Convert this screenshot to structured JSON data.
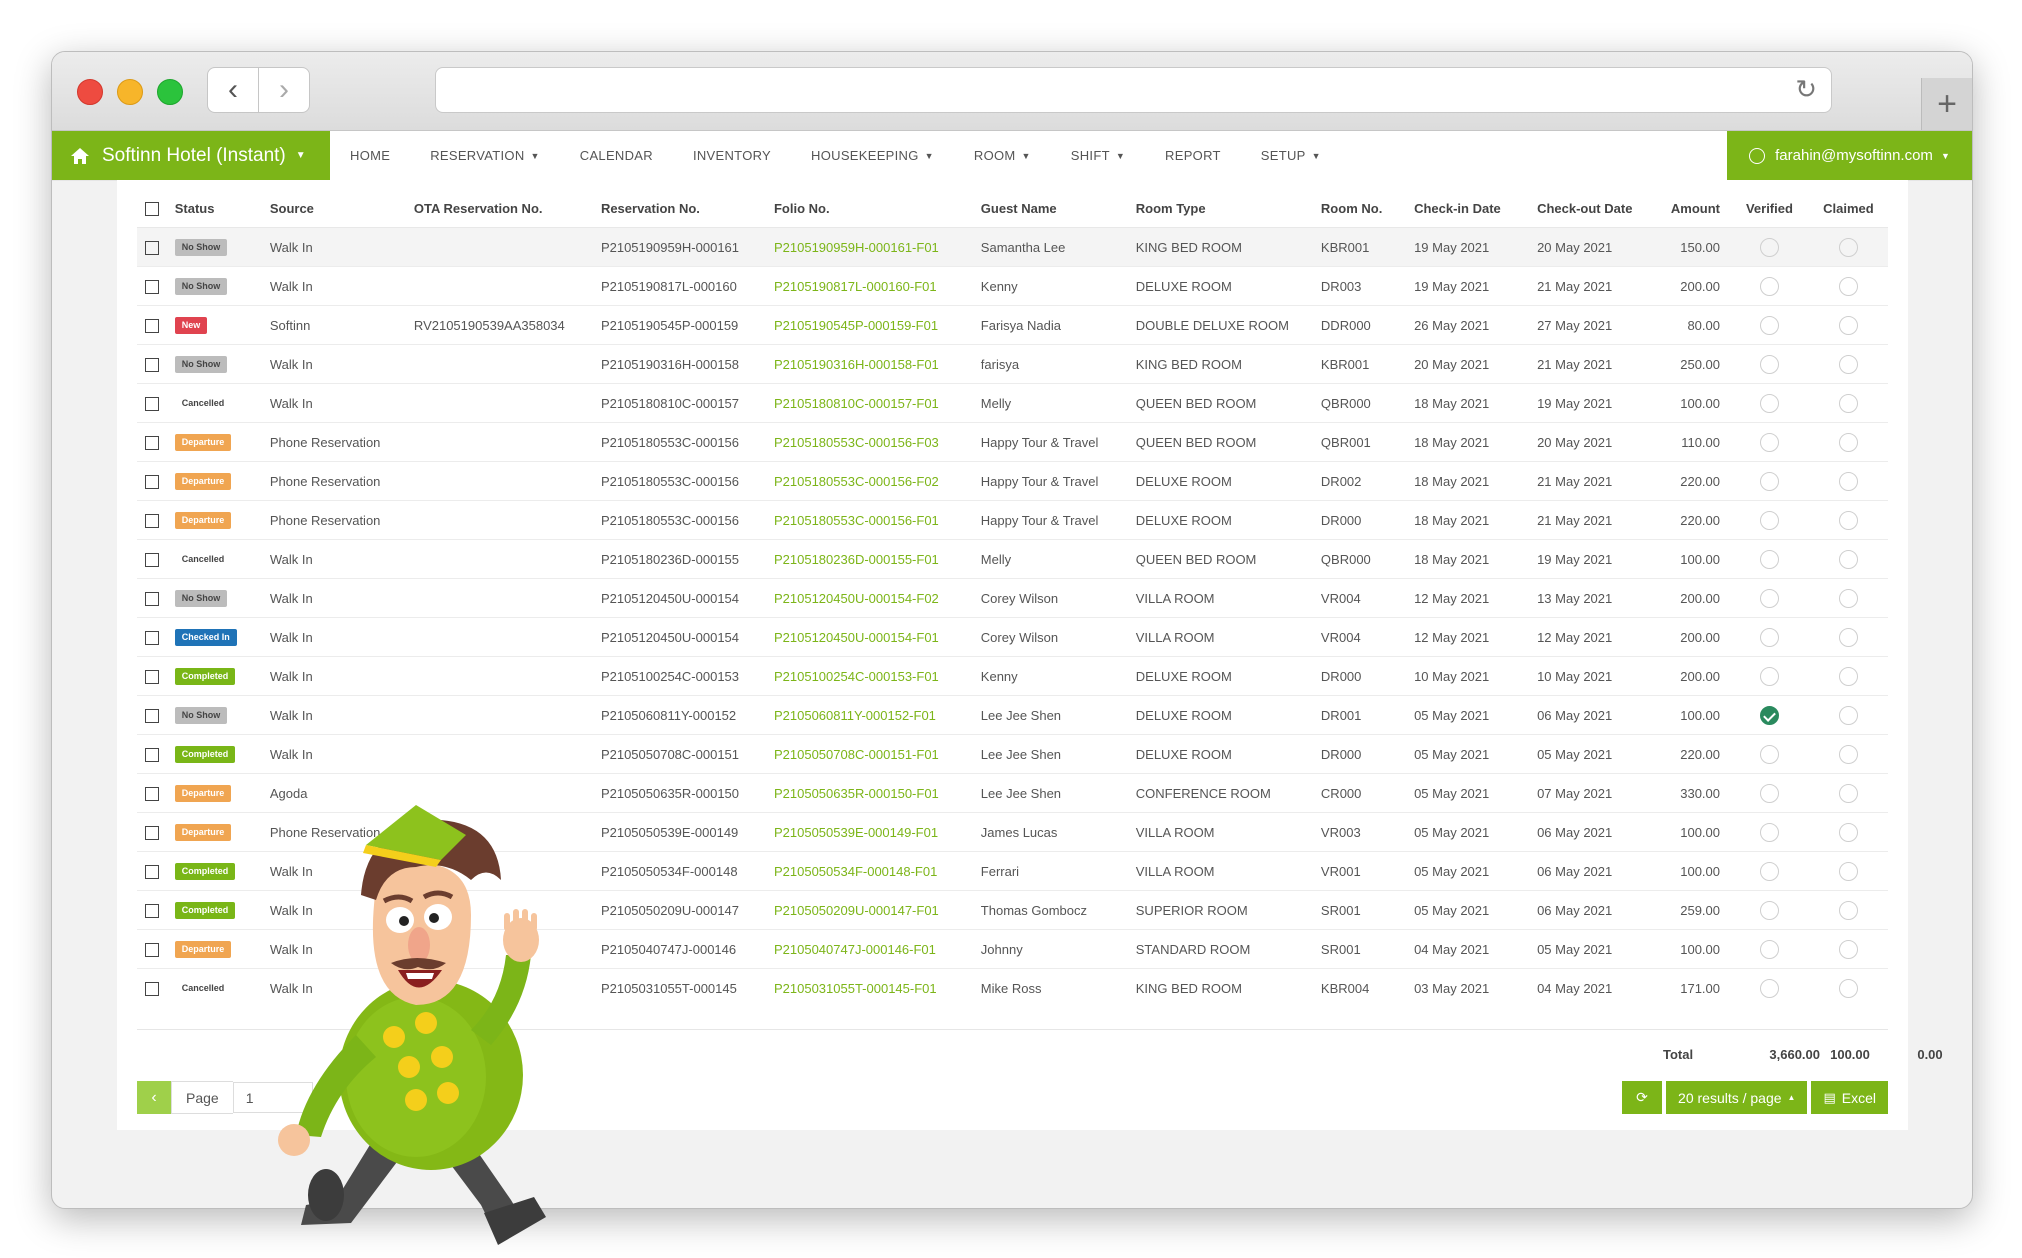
{
  "app": {
    "brand": "Softinn Hotel (Instant)",
    "user": "farahin@mysoftinn.com",
    "menu": [
      "HOME",
      "RESERVATION",
      "CALENDAR",
      "INVENTORY",
      "HOUSEKEEPING",
      "ROOM",
      "SHIFT",
      "REPORT",
      "SETUP"
    ]
  },
  "table": {
    "headers": {
      "status": "Status",
      "source": "Source",
      "ota": "OTA Reservation No.",
      "reservation": "Reservation No.",
      "folio": "Folio No.",
      "guest": "Guest Name",
      "room_type": "Room Type",
      "room_no": "Room No.",
      "checkin": "Check-in Date",
      "checkout": "Check-out Date",
      "amount": "Amount",
      "verified": "Verified",
      "claimed": "Claimed"
    },
    "rows": [
      {
        "status": "No Show",
        "source": "Walk In",
        "ota": "",
        "reservation": "P2105190959H-000161",
        "folio": "P2105190959H-000161-F01",
        "guest": "Samantha Lee",
        "room_type": "KING BED ROOM",
        "room_no": "KBR001",
        "checkin": "19 May 2021",
        "checkout": "20 May 2021",
        "amount": "150.00",
        "verified": false
      },
      {
        "status": "No Show",
        "source": "Walk In",
        "ota": "",
        "reservation": "P2105190817L-000160",
        "folio": "P2105190817L-000160-F01",
        "guest": "Kenny",
        "room_type": "DELUXE ROOM",
        "room_no": "DR003",
        "checkin": "19 May 2021",
        "checkout": "21 May 2021",
        "amount": "200.00",
        "verified": false
      },
      {
        "status": "New",
        "source": "Softinn",
        "ota": "RV2105190539AA358034",
        "reservation": "P2105190545P-000159",
        "folio": "P2105190545P-000159-F01",
        "guest": "Farisya Nadia",
        "room_type": "DOUBLE DELUXE ROOM",
        "room_no": "DDR000",
        "checkin": "26 May 2021",
        "checkout": "27 May 2021",
        "amount": "80.00",
        "verified": false
      },
      {
        "status": "No Show",
        "source": "Walk In",
        "ota": "",
        "reservation": "P2105190316H-000158",
        "folio": "P2105190316H-000158-F01",
        "guest": "farisya",
        "room_type": "KING BED ROOM",
        "room_no": "KBR001",
        "checkin": "20 May 2021",
        "checkout": "21 May 2021",
        "amount": "250.00",
        "verified": false
      },
      {
        "status": "Cancelled",
        "source": "Walk In",
        "ota": "",
        "reservation": "P2105180810C-000157",
        "folio": "P2105180810C-000157-F01",
        "guest": "Melly",
        "room_type": "QUEEN BED ROOM",
        "room_no": "QBR000",
        "checkin": "18 May 2021",
        "checkout": "19 May 2021",
        "amount": "100.00",
        "verified": false
      },
      {
        "status": "Departure",
        "source": "Phone Reservation",
        "ota": "",
        "reservation": "P2105180553C-000156",
        "folio": "P2105180553C-000156-F03",
        "guest": "Happy Tour & Travel",
        "room_type": "QUEEN BED ROOM",
        "room_no": "QBR001",
        "checkin": "18 May 2021",
        "checkout": "20 May 2021",
        "amount": "110.00",
        "verified": false
      },
      {
        "status": "Departure",
        "source": "Phone Reservation",
        "ota": "",
        "reservation": "P2105180553C-000156",
        "folio": "P2105180553C-000156-F02",
        "guest": "Happy Tour & Travel",
        "room_type": "DELUXE ROOM",
        "room_no": "DR002",
        "checkin": "18 May 2021",
        "checkout": "21 May 2021",
        "amount": "220.00",
        "verified": false
      },
      {
        "status": "Departure",
        "source": "Phone Reservation",
        "ota": "",
        "reservation": "P2105180553C-000156",
        "folio": "P2105180553C-000156-F01",
        "guest": "Happy Tour & Travel",
        "room_type": "DELUXE ROOM",
        "room_no": "DR000",
        "checkin": "18 May 2021",
        "checkout": "21 May 2021",
        "amount": "220.00",
        "verified": false
      },
      {
        "status": "Cancelled",
        "source": "Walk In",
        "ota": "",
        "reservation": "P2105180236D-000155",
        "folio": "P2105180236D-000155-F01",
        "guest": "Melly",
        "room_type": "QUEEN BED ROOM",
        "room_no": "QBR000",
        "checkin": "18 May 2021",
        "checkout": "19 May 2021",
        "amount": "100.00",
        "verified": false
      },
      {
        "status": "No Show",
        "source": "Walk In",
        "ota": "",
        "reservation": "P2105120450U-000154",
        "folio": "P2105120450U-000154-F02",
        "guest": "Corey Wilson",
        "room_type": "VILLA ROOM",
        "room_no": "VR004",
        "checkin": "12 May 2021",
        "checkout": "13 May 2021",
        "amount": "200.00",
        "verified": false
      },
      {
        "status": "Checked In",
        "source": "Walk In",
        "ota": "",
        "reservation": "P2105120450U-000154",
        "folio": "P2105120450U-000154-F01",
        "guest": "Corey Wilson",
        "room_type": "VILLA ROOM",
        "room_no": "VR004",
        "checkin": "12 May 2021",
        "checkout": "12 May 2021",
        "amount": "200.00",
        "verified": false
      },
      {
        "status": "Completed",
        "source": "Walk In",
        "ota": "",
        "reservation": "P2105100254C-000153",
        "folio": "P2105100254C-000153-F01",
        "guest": "Kenny",
        "room_type": "DELUXE ROOM",
        "room_no": "DR000",
        "checkin": "10 May 2021",
        "checkout": "10 May 2021",
        "amount": "200.00",
        "verified": false
      },
      {
        "status": "No Show",
        "source": "Walk In",
        "ota": "",
        "reservation": "P2105060811Y-000152",
        "folio": "P2105060811Y-000152-F01",
        "guest": "Lee Jee Shen",
        "room_type": "DELUXE ROOM",
        "room_no": "DR001",
        "checkin": "05 May 2021",
        "checkout": "06 May 2021",
        "amount": "100.00",
        "verified": true
      },
      {
        "status": "Completed",
        "source": "Walk In",
        "ota": "",
        "reservation": "P2105050708C-000151",
        "folio": "P2105050708C-000151-F01",
        "guest": "Lee Jee Shen",
        "room_type": "DELUXE ROOM",
        "room_no": "DR000",
        "checkin": "05 May 2021",
        "checkout": "05 May 2021",
        "amount": "220.00",
        "verified": false
      },
      {
        "status": "Departure",
        "source": "Agoda",
        "ota": "",
        "reservation": "P2105050635R-000150",
        "folio": "P2105050635R-000150-F01",
        "guest": "Lee Jee Shen",
        "room_type": "CONFERENCE ROOM",
        "room_no": "CR000",
        "checkin": "05 May 2021",
        "checkout": "07 May 2021",
        "amount": "330.00",
        "verified": false
      },
      {
        "status": "Departure",
        "source": "Phone Reservation",
        "ota": "",
        "reservation": "P2105050539E-000149",
        "folio": "P2105050539E-000149-F01",
        "guest": "James Lucas",
        "room_type": "VILLA ROOM",
        "room_no": "VR003",
        "checkin": "05 May 2021",
        "checkout": "06 May 2021",
        "amount": "100.00",
        "verified": false
      },
      {
        "status": "Completed",
        "source": "Walk In",
        "ota": "",
        "reservation": "P2105050534F-000148",
        "folio": "P2105050534F-000148-F01",
        "guest": "Ferrari",
        "room_type": "VILLA ROOM",
        "room_no": "VR001",
        "checkin": "05 May 2021",
        "checkout": "06 May 2021",
        "amount": "100.00",
        "verified": false
      },
      {
        "status": "Completed",
        "source": "Walk In",
        "ota": "",
        "reservation": "P2105050209U-000147",
        "folio": "P2105050209U-000147-F01",
        "guest": "Thomas Gombocz",
        "room_type": "SUPERIOR ROOM",
        "room_no": "SR001",
        "checkin": "05 May 2021",
        "checkout": "06 May 2021",
        "amount": "259.00",
        "verified": false
      },
      {
        "status": "Departure",
        "source": "Walk In",
        "ota": "",
        "reservation": "P2105040747J-000146",
        "folio": "P2105040747J-000146-F01",
        "guest": "Johnny",
        "room_type": "STANDARD ROOM",
        "room_no": "SR001",
        "checkin": "04 May 2021",
        "checkout": "05 May 2021",
        "amount": "100.00",
        "verified": false
      },
      {
        "status": "Cancelled",
        "source": "Walk In",
        "ota": "",
        "reservation": "P2105031055T-000145",
        "folio": "P2105031055T-000145-F01",
        "guest": "Mike Ross",
        "room_type": "KING BED ROOM",
        "room_no": "KBR004",
        "checkin": "03 May 2021",
        "checkout": "04 May 2021",
        "amount": "171.00",
        "verified": false
      }
    ]
  },
  "totals": {
    "label": "Total",
    "amount": "3,660.00",
    "verified": "100.00",
    "claimed": "0.00"
  },
  "pagination": {
    "label": "Page",
    "value": "1",
    "page_size": "20 results / page",
    "excel": "Excel"
  },
  "colors": {
    "accent": "#7cb518",
    "link": "#7cb518",
    "new": "#e0434f",
    "departure": "#f0a551",
    "checked_in": "#1f73b7",
    "completed": "#79b617",
    "no_show": "#bcbcbc",
    "verified": "#2a8a5e"
  }
}
